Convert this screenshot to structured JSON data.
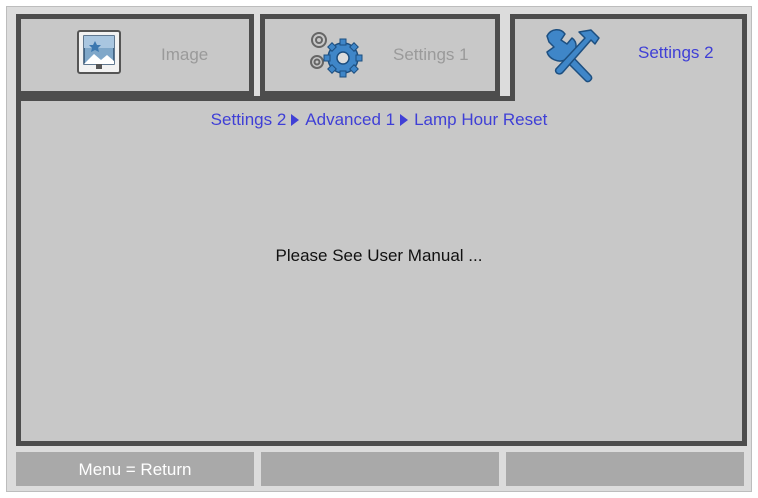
{
  "tabs": [
    {
      "label": "Image",
      "icon": "image-icon",
      "active": false
    },
    {
      "label": "Settings 1",
      "icon": "gears-icon",
      "active": false
    },
    {
      "label": "Settings 2",
      "icon": "tools-icon",
      "active": true
    }
  ],
  "breadcrumb": {
    "items": [
      "Settings 2",
      "Advanced 1",
      "Lamp Hour Reset"
    ]
  },
  "message": "Please See User Manual ...",
  "footer": {
    "items": [
      "Menu = Return",
      "",
      ""
    ]
  },
  "colors": {
    "active_text": "#3f3fd6",
    "inactive_text": "#9a9a9a",
    "panel_bg": "#c8c8c8",
    "outline": "#4d4d4d",
    "footer_bg": "#a9a9a9"
  }
}
